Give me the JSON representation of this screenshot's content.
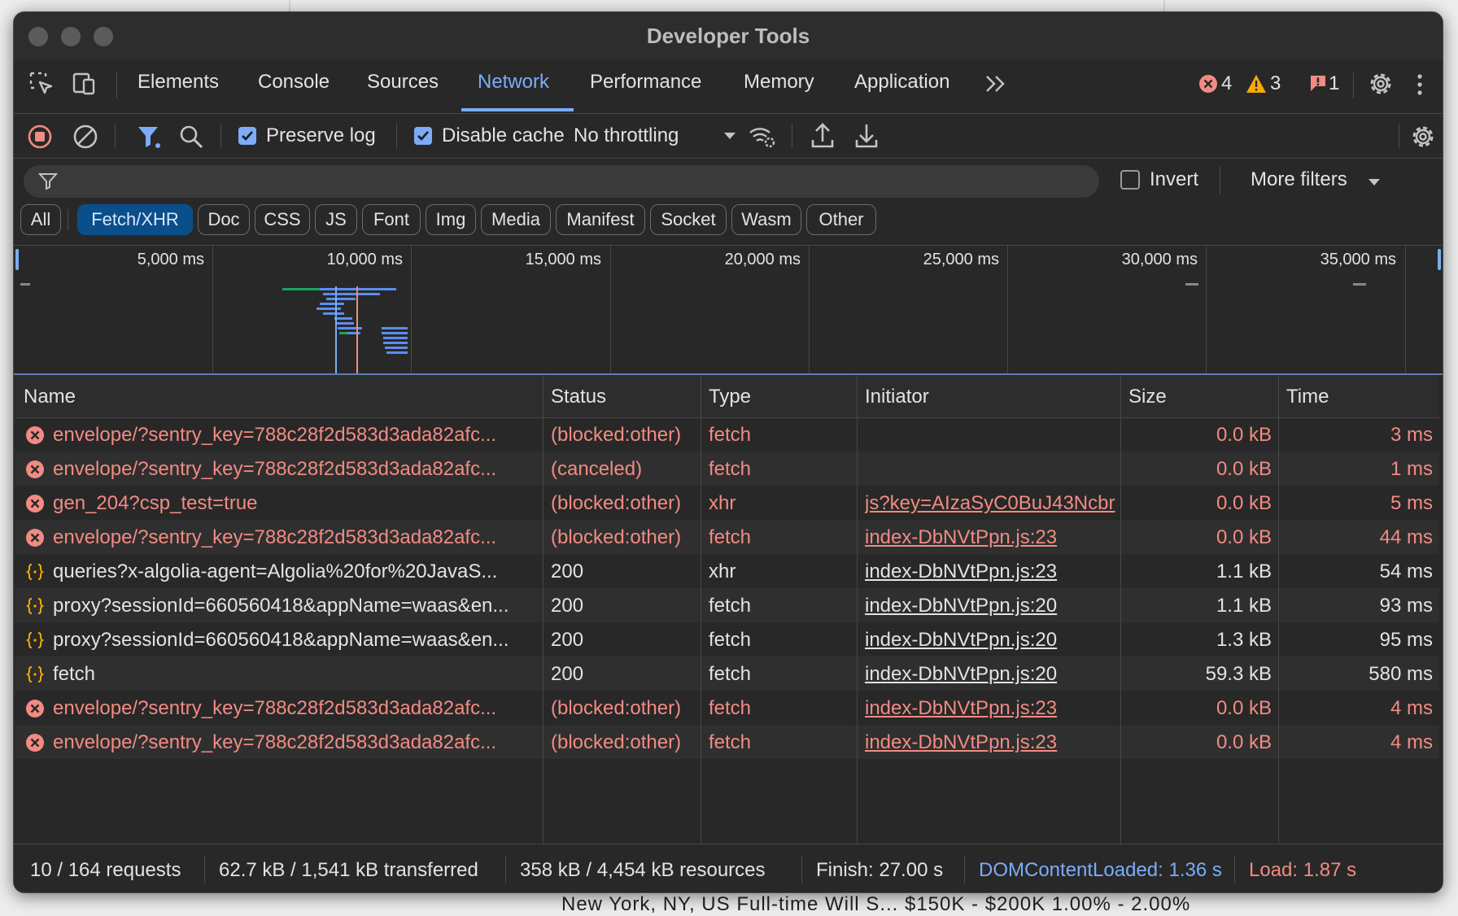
{
  "window": {
    "title": "Developer Tools"
  },
  "tabs": [
    {
      "label": "Elements"
    },
    {
      "label": "Console"
    },
    {
      "label": "Sources"
    },
    {
      "label": "Network"
    },
    {
      "label": "Performance"
    },
    {
      "label": "Memory"
    },
    {
      "label": "Application"
    }
  ],
  "active_tab": "Network",
  "counters": {
    "errors": "4",
    "warnings": "3",
    "issues": "1"
  },
  "toolbar": {
    "preserve_log": {
      "label": "Preserve log",
      "checked": true
    },
    "disable_cache": {
      "label": "Disable cache",
      "checked": true
    },
    "throttling": "No throttling"
  },
  "filter": {
    "invert_label": "Invert",
    "invert_checked": false,
    "more_filters": "More filters",
    "types": [
      "All",
      "Fetch/XHR",
      "Doc",
      "CSS",
      "JS",
      "Font",
      "Img",
      "Media",
      "Manifest",
      "Socket",
      "Wasm",
      "Other"
    ],
    "active_type": "Fetch/XHR"
  },
  "overview": {
    "tick_labels": [
      "5,000 ms",
      "10,000 ms",
      "15,000 ms",
      "20,000 ms",
      "25,000 ms",
      "30,000 ms",
      "35,000 ms"
    ],
    "domcontentloaded_ms": 1360,
    "load_ms": 1870
  },
  "table": {
    "columns": [
      "Name",
      "Status",
      "Type",
      "Initiator",
      "Size",
      "Time"
    ],
    "rows": [
      {
        "icon": "error",
        "name": "envelope/?sentry_key=788c28f2d583d3ada82afc...",
        "status": "(blocked:other)",
        "type": "fetch",
        "initiator": "",
        "size": "0.0 kB",
        "time": "3 ms"
      },
      {
        "icon": "error",
        "name": "envelope/?sentry_key=788c28f2d583d3ada82afc...",
        "status": "(canceled)",
        "type": "fetch",
        "initiator": "",
        "size": "0.0 kB",
        "time": "1 ms"
      },
      {
        "icon": "error",
        "name": "gen_204?csp_test=true",
        "status": "(blocked:other)",
        "type": "xhr",
        "initiator": "js?key=AIzaSyC0BuJ43Ncbr",
        "size": "0.0 kB",
        "time": "5 ms"
      },
      {
        "icon": "error",
        "name": "envelope/?sentry_key=788c28f2d583d3ada82afc...",
        "status": "(blocked:other)",
        "type": "fetch",
        "initiator": "index-DbNVtPpn.js:23",
        "size": "0.0 kB",
        "time": "44 ms"
      },
      {
        "icon": "fetch",
        "name": "queries?x-algolia-agent=Algolia%20for%20JavaS...",
        "status": "200",
        "type": "xhr",
        "initiator": "index-DbNVtPpn.js:23",
        "size": "1.1 kB",
        "time": "54 ms"
      },
      {
        "icon": "fetch",
        "name": "proxy?sessionId=660560418&appName=waas&en...",
        "status": "200",
        "type": "fetch",
        "initiator": "index-DbNVtPpn.js:20",
        "size": "1.1 kB",
        "time": "93 ms"
      },
      {
        "icon": "fetch",
        "name": "proxy?sessionId=660560418&appName=waas&en...",
        "status": "200",
        "type": "fetch",
        "initiator": "index-DbNVtPpn.js:20",
        "size": "1.3 kB",
        "time": "95 ms"
      },
      {
        "icon": "fetch",
        "name": "fetch",
        "status": "200",
        "type": "fetch",
        "initiator": "index-DbNVtPpn.js:20",
        "size": "59.3 kB",
        "time": "580 ms"
      },
      {
        "icon": "error",
        "name": "envelope/?sentry_key=788c28f2d583d3ada82afc...",
        "status": "(blocked:other)",
        "type": "fetch",
        "initiator": "index-DbNVtPpn.js:23",
        "size": "0.0 kB",
        "time": "4 ms"
      },
      {
        "icon": "error",
        "name": "envelope/?sentry_key=788c28f2d583d3ada82afc...",
        "status": "(blocked:other)",
        "type": "fetch",
        "initiator": "index-DbNVtPpn.js:23",
        "size": "0.0 kB",
        "time": "4 ms"
      }
    ]
  },
  "status_bar": {
    "requests": "10 / 164 requests",
    "transferred": "62.7 kB / 1,541 kB transferred",
    "resources": "358 kB / 4,454 kB resources",
    "finish": "Finish: 27.00 s",
    "dcl": "DOMContentLoaded: 1.36 s",
    "load": "Load: 1.87 s"
  },
  "background": {
    "text": "New York, NY, US  Full-time   Will S...   $150K - $200K   1.00% - 2.00%"
  },
  "colors": {
    "accent": "#7cacf8",
    "error": "#f28b82",
    "warning": "#f9ab00",
    "dcl": "#7cacf8",
    "load": "#f28b82"
  }
}
